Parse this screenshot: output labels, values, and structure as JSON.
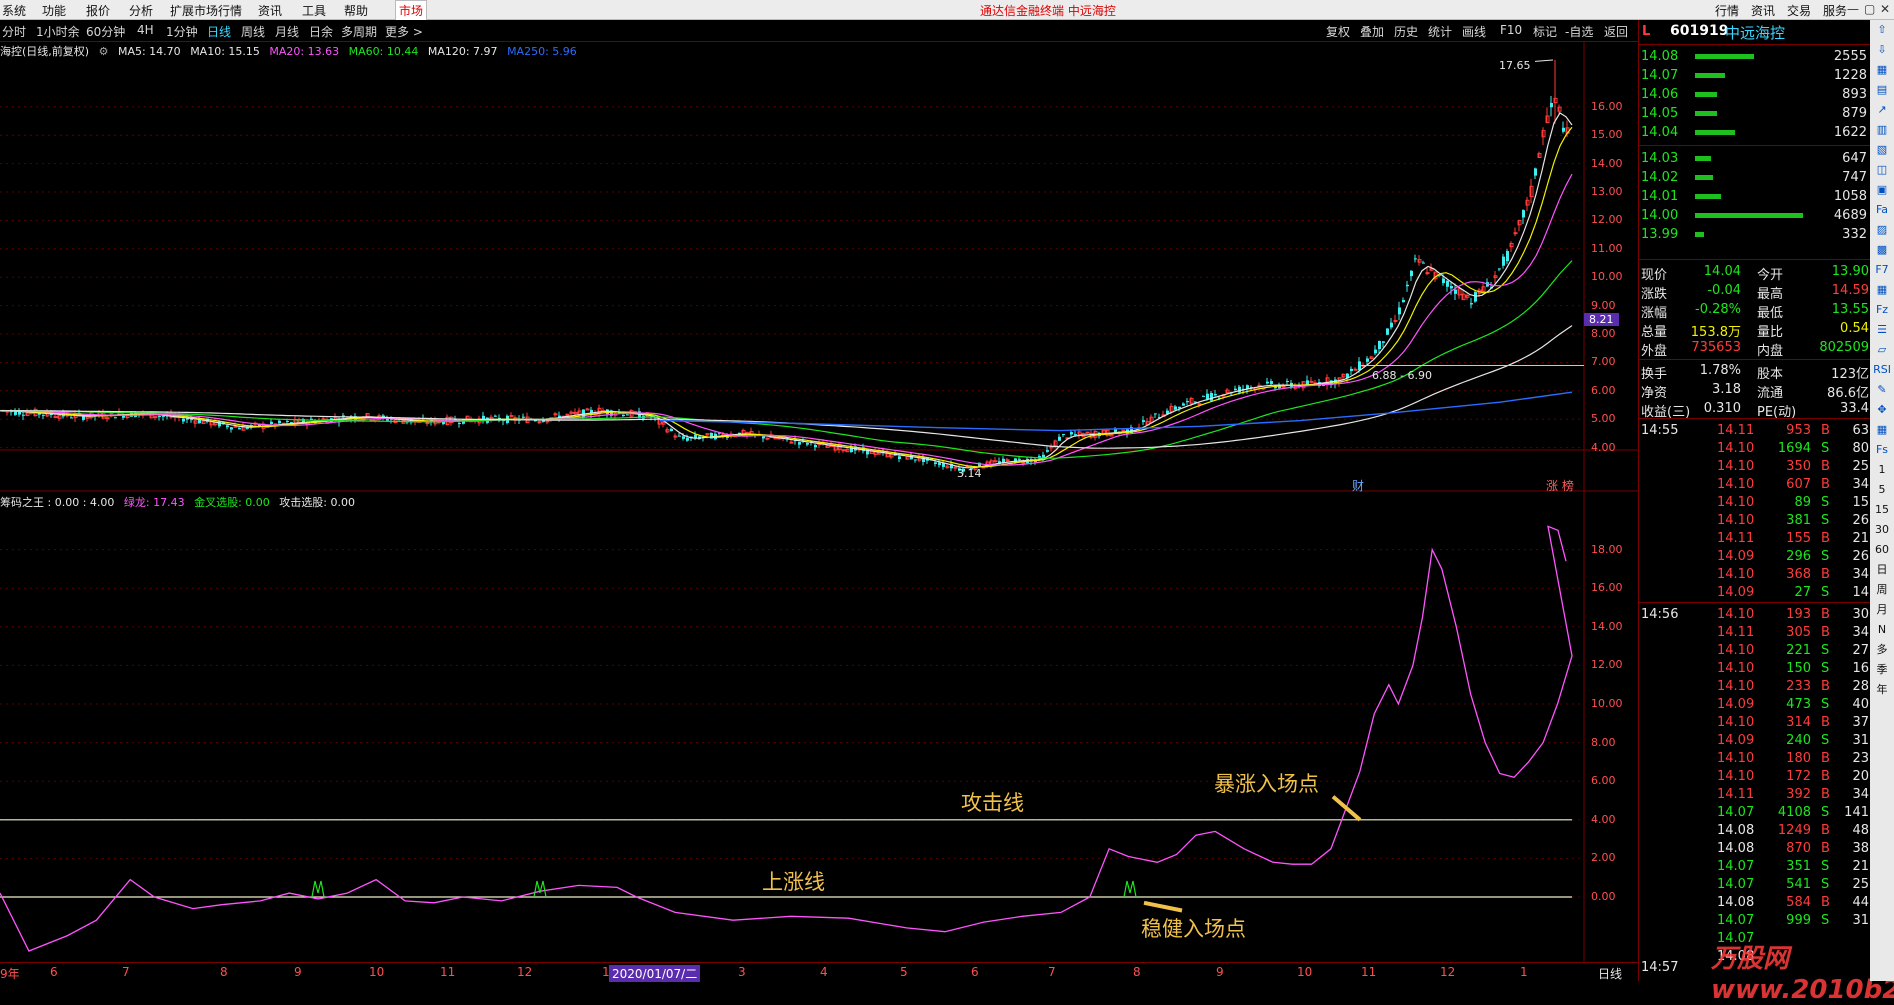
{
  "menu": {
    "items": [
      "系统",
      "功能",
      "报价",
      "分析",
      "扩展市场行情",
      "资讯",
      "工具",
      "帮助"
    ],
    "market_tab": "市场",
    "title": "通达信金融终端  中远海控",
    "right_buttons": [
      "行情",
      "资讯",
      "交易",
      "服务"
    ]
  },
  "toolbar": {
    "periods": [
      "分时",
      "1小时余",
      "60分钟",
      "4H",
      "1分钟",
      "日线",
      "周线",
      "月线",
      "日余",
      "多周期",
      "更多 >"
    ],
    "active_period": "日线",
    "right_buttons": [
      "复权",
      "叠加",
      "历史",
      "统计",
      "画线",
      "F10",
      "标记",
      "-自选",
      "返回"
    ]
  },
  "main_chart": {
    "stock_title": "海控(日线,前复权)",
    "ma_legend": [
      {
        "label": "MA5: 14.70",
        "color": "#e6e6e6"
      },
      {
        "label": "MA10: 15.15",
        "color": "#f0f000"
      },
      {
        "label": "MA20: 13.63",
        "color": "#ff54ff"
      },
      {
        "label": "MA60: 10.44",
        "color": "#1ee61e"
      },
      {
        "label": "MA120: 7.97",
        "color": "#e6e6e6"
      },
      {
        "label": "MA250: 5.96",
        "color": "#2a6cff"
      }
    ],
    "y_ticks": [
      "16.00",
      "15.00",
      "14.00",
      "13.00",
      "12.00",
      "11.00",
      "10.00",
      "9.00",
      "8.00",
      "7.00",
      "6.00",
      "5.00",
      "4.00"
    ],
    "high_label": "17.65",
    "low_label": "3.14",
    "range_label": "6.88 - 6.90",
    "current_price_tag": "8.21",
    "markers": [
      "财",
      "涨 榜"
    ]
  },
  "sub_chart": {
    "legend": [
      {
        "label": "筹码之王 : 0.00 : 4.00",
        "color": "#e6e6e6"
      },
      {
        "label": "绿龙: 17.43",
        "color": "#ff54ff"
      },
      {
        "label": "金叉选股: 0.00",
        "color": "#1ee61e"
      },
      {
        "label": "攻击选股: 0.00",
        "color": "#e6e6e6"
      }
    ],
    "y_ticks": [
      "18.00",
      "16.00",
      "14.00",
      "12.00",
      "10.00",
      "8.00",
      "6.00",
      "4.00",
      "2.00",
      "0.00"
    ],
    "annotations": {
      "attack_line": "攻击线",
      "rise_line": "上涨线",
      "surge_entry": "暴涨入场点",
      "steady_entry": "稳健入场点"
    }
  },
  "x_axis": {
    "labels": [
      "9年",
      "6",
      "7",
      "8",
      "9",
      "10",
      "11",
      "12",
      "1",
      "2020/01/07/二",
      "3",
      "4",
      "5",
      "6",
      "7",
      "8",
      "9",
      "10",
      "11",
      "12",
      "1"
    ],
    "period": "日线"
  },
  "quote": {
    "market_flag": "L",
    "code": "601919",
    "name": "中远海控",
    "sell_orders": [
      {
        "price": "14.08",
        "vol": "2555",
        "bar": 0.55
      },
      {
        "price": "14.07",
        "vol": "1228",
        "bar": 0.28
      },
      {
        "price": "14.06",
        "vol": "893",
        "bar": 0.2
      },
      {
        "price": "14.05",
        "vol": "879",
        "bar": 0.2
      },
      {
        "price": "14.04",
        "vol": "1622",
        "bar": 0.37
      }
    ],
    "buy_orders": [
      {
        "price": "14.03",
        "vol": "647",
        "bar": 0.15
      },
      {
        "price": "14.02",
        "vol": "747",
        "bar": 0.17
      },
      {
        "price": "14.01",
        "vol": "1058",
        "bar": 0.24
      },
      {
        "price": "14.00",
        "vol": "4689",
        "bar": 1.0
      },
      {
        "price": "13.99",
        "vol": "332",
        "bar": 0.08
      }
    ],
    "stats": [
      {
        "l1": "现价",
        "v1": "14.04",
        "c1": "green",
        "l2": "今开",
        "v2": "13.90",
        "c2": "green"
      },
      {
        "l1": "涨跌",
        "v1": "-0.04",
        "c1": "green",
        "l2": "最高",
        "v2": "14.59",
        "c2": "red"
      },
      {
        "l1": "涨幅",
        "v1": "-0.28%",
        "c1": "green",
        "l2": "最低",
        "v2": "13.55",
        "c2": "green"
      },
      {
        "l1": "总量",
        "v1": "153.8万",
        "c1": "yellow",
        "l2": "量比",
        "v2": "0.54",
        "c2": "yellow"
      },
      {
        "l1": "外盘",
        "v1": "735653",
        "c1": "red",
        "l2": "内盘",
        "v2": "802509",
        "c2": "green"
      },
      {
        "l1": "换手",
        "v1": "1.78%",
        "c1": "white",
        "l2": "股本",
        "v2": "123亿",
        "c2": "white"
      },
      {
        "l1": "净资",
        "v1": "3.18",
        "c1": "white",
        "l2": "流通",
        "v2": "86.6亿",
        "c2": "white"
      },
      {
        "l1": "收益(三)",
        "v1": "0.310",
        "c1": "white",
        "l2": "PE(动)",
        "v2": "33.4",
        "c2": "white"
      }
    ],
    "ticks_1": {
      "time": "14:55",
      "rows": [
        {
          "p": "14.11",
          "v": "953",
          "s": "B",
          "n": "63",
          "pc": "red"
        },
        {
          "p": "14.10",
          "v": "1694",
          "s": "S",
          "n": "80",
          "pc": "red"
        },
        {
          "p": "14.10",
          "v": "350",
          "s": "B",
          "n": "25",
          "pc": "red"
        },
        {
          "p": "14.10",
          "v": "607",
          "s": "B",
          "n": "34",
          "pc": "red"
        },
        {
          "p": "14.10",
          "v": "89",
          "s": "S",
          "n": "15",
          "pc": "red"
        },
        {
          "p": "14.10",
          "v": "381",
          "s": "S",
          "n": "26",
          "pc": "red"
        },
        {
          "p": "14.11",
          "v": "155",
          "s": "B",
          "n": "21",
          "pc": "red"
        },
        {
          "p": "14.09",
          "v": "296",
          "s": "S",
          "n": "26",
          "pc": "red"
        },
        {
          "p": "14.10",
          "v": "368",
          "s": "B",
          "n": "34",
          "pc": "red"
        },
        {
          "p": "14.09",
          "v": "27",
          "s": "S",
          "n": "14",
          "pc": "red"
        }
      ]
    },
    "ticks_2": {
      "time": "14:56",
      "rows": [
        {
          "p": "14.10",
          "v": "193",
          "s": "B",
          "n": "30",
          "pc": "red"
        },
        {
          "p": "14.11",
          "v": "305",
          "s": "B",
          "n": "34",
          "pc": "red"
        },
        {
          "p": "14.10",
          "v": "221",
          "s": "S",
          "n": "27",
          "pc": "red"
        },
        {
          "p": "14.10",
          "v": "150",
          "s": "S",
          "n": "16",
          "pc": "red"
        },
        {
          "p": "14.10",
          "v": "233",
          "s": "B",
          "n": "28",
          "pc": "red"
        },
        {
          "p": "14.09",
          "v": "473",
          "s": "S",
          "n": "40",
          "pc": "red"
        },
        {
          "p": "14.10",
          "v": "314",
          "s": "B",
          "n": "37",
          "pc": "red"
        },
        {
          "p": "14.09",
          "v": "240",
          "s": "S",
          "n": "31",
          "pc": "red"
        },
        {
          "p": "14.10",
          "v": "180",
          "s": "B",
          "n": "23",
          "pc": "red"
        },
        {
          "p": "14.10",
          "v": "172",
          "s": "B",
          "n": "20",
          "pc": "red"
        },
        {
          "p": "14.11",
          "v": "392",
          "s": "B",
          "n": "34",
          "pc": "red"
        },
        {
          "p": "14.07",
          "v": "4108",
          "s": "S",
          "n": "141",
          "pc": "green"
        },
        {
          "p": "14.08",
          "v": "1249",
          "s": "B",
          "n": "48",
          "pc": "white"
        },
        {
          "p": "14.08",
          "v": "870",
          "s": "B",
          "n": "38",
          "pc": "white"
        },
        {
          "p": "14.07",
          "v": "351",
          "s": "S",
          "n": "21",
          "pc": "green"
        },
        {
          "p": "14.07",
          "v": "541",
          "s": "S",
          "n": "25",
          "pc": "green"
        },
        {
          "p": "14.08",
          "v": "584",
          "s": "B",
          "n": "44",
          "pc": "white"
        },
        {
          "p": "14.07",
          "v": "999",
          "s": "S",
          "n": "31",
          "pc": "green"
        },
        {
          "p": "14.07",
          "v": "",
          "s": "",
          "n": "",
          "pc": "green"
        },
        {
          "p": "14.08",
          "v": "",
          "s": "",
          "n": "",
          "pc": "white"
        }
      ]
    },
    "bottom_time": "14:57"
  },
  "sidebar_labels": [
    "1",
    "5",
    "15",
    "30",
    "60",
    "日",
    "周",
    "月",
    "N",
    "多",
    "季",
    "年"
  ],
  "watermark": "万股网 www.2010b2.com"
}
